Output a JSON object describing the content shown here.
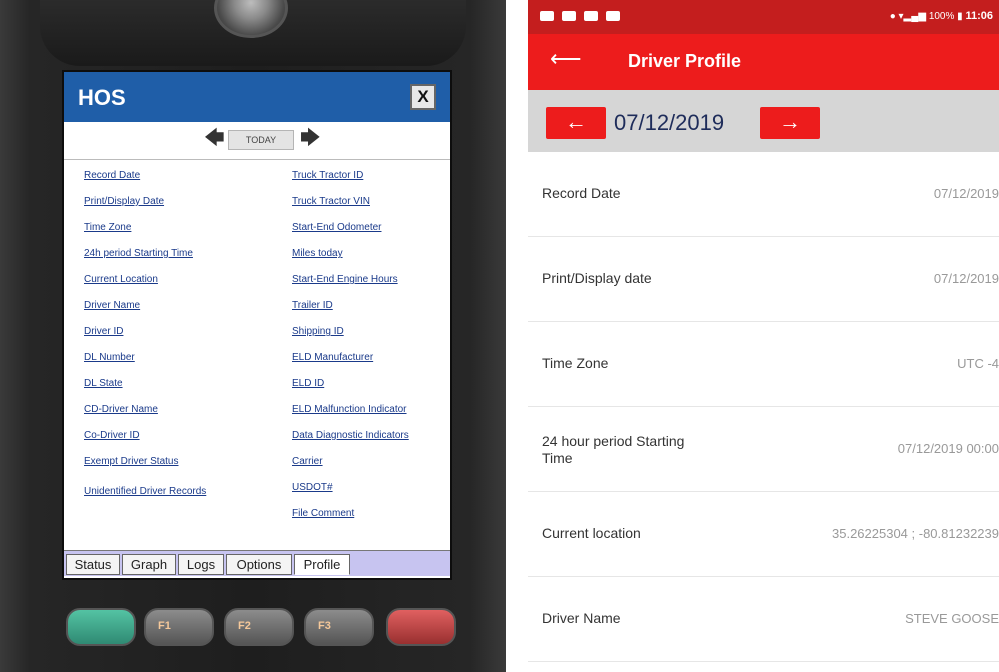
{
  "left_device": {
    "window_title": "HOS",
    "close_label": "X",
    "today_label": "TODAY",
    "nav_prev_glyph": "🡄",
    "nav_next_glyph": "🡆",
    "fields_col1": [
      "Record Date",
      "Print/Display Date",
      "Time Zone",
      "24h period Starting Time",
      "Current Location",
      "Driver Name",
      "Driver ID",
      "DL Number",
      "DL State",
      "CD-Driver Name",
      "Co-Driver ID",
      "Exempt Driver Status",
      "Unidentified Driver Records"
    ],
    "fields_col2": [
      "Truck Tractor ID",
      "Truck Tractor VIN",
      "Start-End Odometer",
      "Miles today",
      "Start-End Engine Hours",
      "Trailer ID",
      "Shipping ID",
      "ELD Manufacturer",
      "ELD ID",
      "ELD Malfunction Indicator",
      "Data Diagnostic Indicators",
      "Carrier",
      "USDOT#",
      "File Comment"
    ],
    "tabs": [
      "Status",
      "Graph",
      "Logs",
      "Options",
      "Profile"
    ],
    "active_tab": "Profile",
    "keys": {
      "f1": "F1",
      "f2": "F2",
      "f3": "F3"
    }
  },
  "right_app": {
    "status_bar": {
      "battery": "100%",
      "time": "11:06"
    },
    "app_title": "Driver Profile",
    "back_glyph": "⟵",
    "date_prev_glyph": "←",
    "date_next_glyph": "→",
    "date": "07/12/2019",
    "rows": [
      {
        "label": "Record Date",
        "value": "07/12/2019"
      },
      {
        "label": "Print/Display date",
        "value": "07/12/2019"
      },
      {
        "label": "Time Zone",
        "value": "UTC -4"
      },
      {
        "label": "24 hour period Starting Time",
        "value": "07/12/2019 00:00"
      },
      {
        "label": "Current location",
        "value": "35.26225304 ; -80.81232239"
      },
      {
        "label": "Driver Name",
        "value": "STEVE GOOSE"
      }
    ]
  }
}
